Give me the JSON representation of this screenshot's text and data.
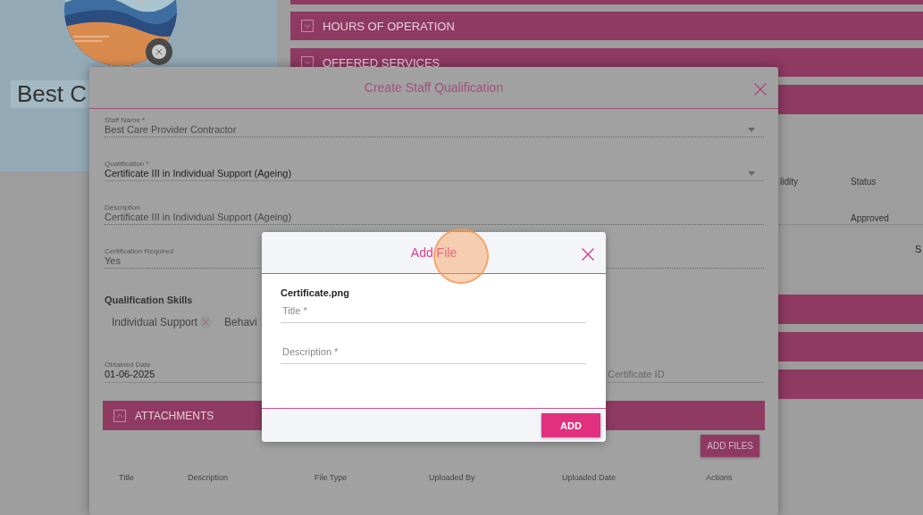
{
  "profile": {
    "name": "Best C"
  },
  "sections": [
    {
      "label": "HOURS OF OPERATION",
      "expanded": false
    },
    {
      "label": "OFFERED SERVICES",
      "expanded": false
    }
  ],
  "background_table": {
    "columns": [
      "lidity",
      "Status"
    ],
    "status": "Approved",
    "cut_text": "S"
  },
  "staff_modal": {
    "title": "Create Staff Qualification",
    "fields": [
      {
        "label": "Staff Name *",
        "value": "Best Care Provider Contractor",
        "kind": "select",
        "disabled": true
      },
      {
        "label": "Qualification *",
        "value": "Certificate III in Individual Support (Ageing)",
        "kind": "select",
        "disabled": false
      },
      {
        "label": "Description",
        "value": "Certificate III in Individual Support (Ageing)",
        "kind": "text",
        "disabled": true
      },
      {
        "label": "Certification Required",
        "value": "Yes",
        "kind": "text",
        "disabled": true
      }
    ],
    "skills_heading": "Qualification Skills",
    "skills": [
      {
        "label": "Individual Support",
        "removable": true
      },
      {
        "label": "Behavi",
        "removable": false
      }
    ],
    "obtained_date": {
      "label": "Obtained Date",
      "value": "01-06-2025"
    },
    "certificate_id": {
      "placeholder": "Certificate ID"
    },
    "attachments": {
      "title": "ATTACHMENTS",
      "expanded": true
    },
    "add_files_button": "ADD FILES",
    "columns": [
      "Title",
      "Description",
      "File Type",
      "Uploaded By",
      "Uploaded Date",
      "Actions"
    ]
  },
  "file_modal": {
    "title": "Add File",
    "file_name": "Certificate.png",
    "fields": [
      {
        "placeholder": "Title *"
      },
      {
        "placeholder": "Description *"
      }
    ],
    "button": "ADD"
  }
}
